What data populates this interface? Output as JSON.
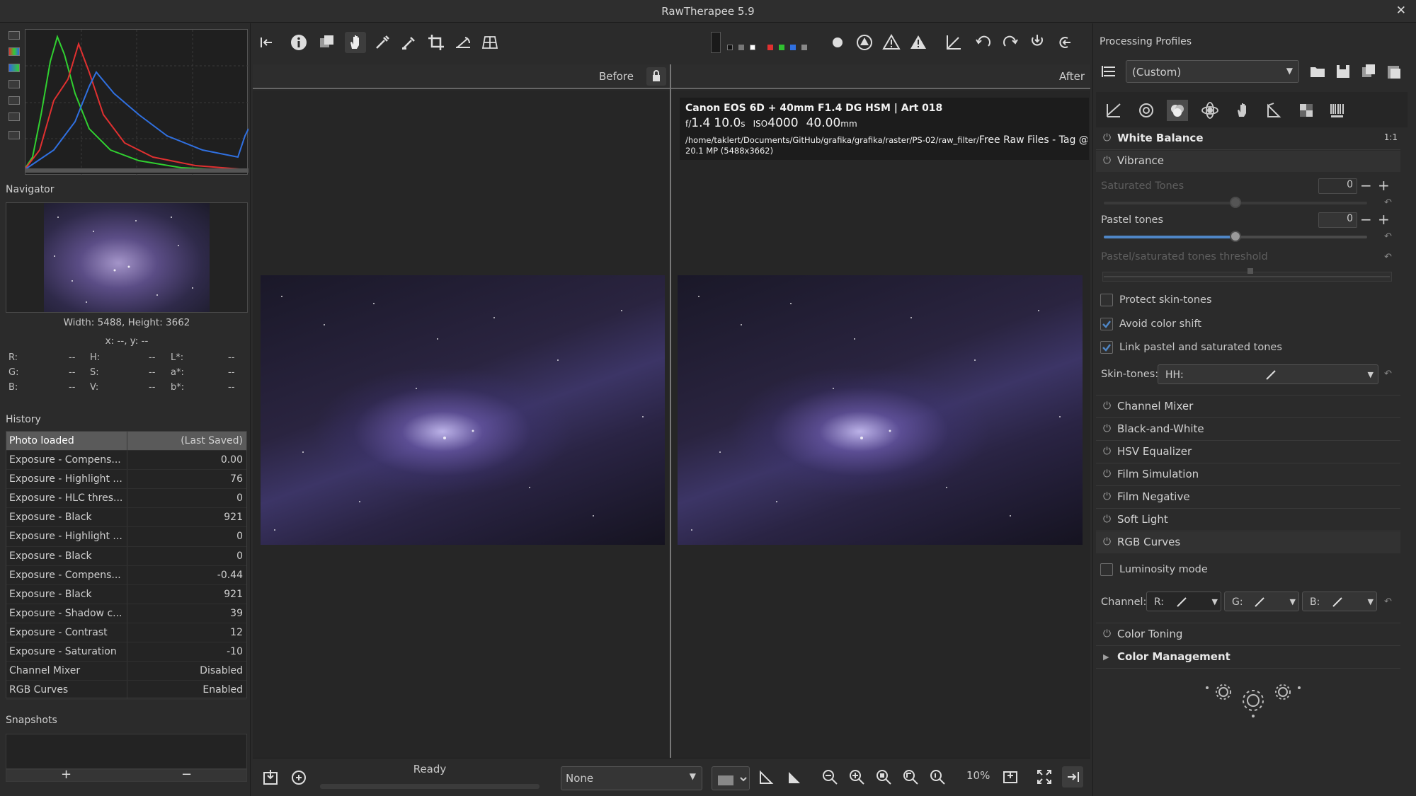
{
  "window": {
    "title": "RawTherapee 5.9",
    "close_label": "✕"
  },
  "left": {
    "navigator": {
      "title": "Navigator",
      "size_text": "Width: 5488, Height: 3662",
      "coords_text": "x: --, y: --"
    },
    "pixel_values": [
      {
        "k1": "R:",
        "v1": "--",
        "k2": "H:",
        "v2": "--",
        "k3": "L*:",
        "v3": "--"
      },
      {
        "k1": "G:",
        "v1": "--",
        "k2": "S:",
        "v2": "--",
        "k3": "a*:",
        "v3": "--"
      },
      {
        "k1": "B:",
        "v1": "--",
        "k2": "V:",
        "v2": "--",
        "k3": "b*:",
        "v3": "--"
      }
    ],
    "history": {
      "title": "History",
      "rows": [
        {
          "action": "Photo loaded",
          "value": "(Last Saved)"
        },
        {
          "action": "Exposure - Compens...",
          "value": "0.00"
        },
        {
          "action": "Exposure - Highlight ...",
          "value": "76"
        },
        {
          "action": "Exposure - HLC thres...",
          "value": "0"
        },
        {
          "action": "Exposure - Black",
          "value": "921"
        },
        {
          "action": "Exposure - Highlight ...",
          "value": "0"
        },
        {
          "action": "Exposure - Black",
          "value": "0"
        },
        {
          "action": "Exposure - Compens...",
          "value": "-0.44"
        },
        {
          "action": "Exposure - Black",
          "value": "921"
        },
        {
          "action": "Exposure - Shadow c...",
          "value": "39"
        },
        {
          "action": "Exposure - Contrast",
          "value": "12"
        },
        {
          "action": "Exposure - Saturation",
          "value": "-10"
        },
        {
          "action": "Channel Mixer",
          "value": "Disabled"
        },
        {
          "action": "RGB Curves",
          "value": "Enabled"
        }
      ]
    },
    "snapshots": {
      "title": "Snapshots",
      "add_label": "+",
      "remove_label": "−"
    }
  },
  "center": {
    "before_label": "Before",
    "after_label": "After",
    "exif": {
      "camera": "Canon EOS 6D + 40mm F1.4 DG HSM | Art 018",
      "fnum_prefix": "f/",
      "fnum": "1.4",
      "shutter": "10.0",
      "shutter_unit": "s",
      "iso_prefix": "ISO",
      "iso": "4000",
      "focal": "40.00",
      "focal_unit": "mm",
      "path": "/home/taklert/Documents/GitHub/grafika/grafika/raster/PS-02/raw_filter/",
      "file_title": "Free Raw Files - Tag @signa",
      "megapixels": "20.1 MP (5488x3662)"
    },
    "status": "Ready",
    "select_none": "None",
    "zoom": "10%"
  },
  "right": {
    "profiles": {
      "title": "Processing Profiles",
      "current": "(Custom)"
    },
    "white_balance": {
      "title": "White Balance",
      "ratio_label": "1:1"
    },
    "vibrance": {
      "title": "Vibrance",
      "saturated_tones": {
        "label": "Saturated Tones",
        "value": "0"
      },
      "pastel_tones": {
        "label": "Pastel tones",
        "value": "0"
      },
      "threshold_label": "Pastel/saturated tones threshold",
      "protect_skin": {
        "label": "Protect skin-tones",
        "checked": false
      },
      "avoid_shift": {
        "label": "Avoid color shift",
        "checked": true
      },
      "link_tones": {
        "label": "Link pastel and saturated tones",
        "checked": true
      },
      "skin_tones_label": "Skin-tones:",
      "skin_tones_curve": "HH:"
    },
    "tools": [
      "Channel Mixer",
      "Black-and-White",
      "HSV Equalizer",
      "Film Simulation",
      "Film Negative",
      "Soft Light",
      "RGB Curves"
    ],
    "rgb_curves": {
      "luminosity_mode": {
        "label": "Luminosity mode",
        "checked": false
      },
      "channel_label": "Channel:",
      "r": "R:",
      "g": "G:",
      "b": "B:"
    },
    "color_toning": "Color Toning",
    "color_management": "Color Management"
  },
  "colors": {
    "accent": "#4f86c6",
    "histo_red": "#e03030",
    "histo_green": "#30d030",
    "histo_blue": "#3070e0"
  }
}
